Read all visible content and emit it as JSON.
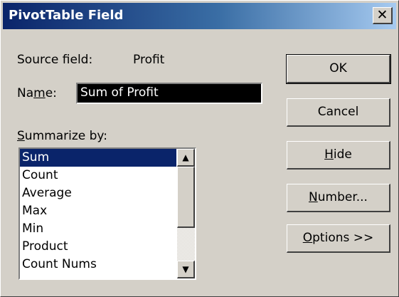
{
  "window": {
    "title": "PivotTable Field",
    "close_glyph": "✕"
  },
  "source": {
    "label": "Source field:",
    "value": "Profit"
  },
  "name": {
    "label_pre": "Na",
    "label_ul": "m",
    "label_post": "e:",
    "value": "Sum of Profit"
  },
  "summarize": {
    "label_ul": "S",
    "label_rest": "ummarize by:"
  },
  "functions": [
    "Sum",
    "Count",
    "Average",
    "Max",
    "Min",
    "Product",
    "Count Nums"
  ],
  "selected_function": "Sum",
  "scrollbar": {
    "up_icon": "up-arrow-icon",
    "down_icon": "down-arrow-icon"
  },
  "buttons": {
    "ok": "OK",
    "cancel": "Cancel",
    "hide": {
      "ul": "H",
      "rest": "ide"
    },
    "number": {
      "ul": "N",
      "rest": "umber..."
    },
    "options": {
      "ul": "O",
      "rest": "ptions >>"
    }
  },
  "colors": {
    "title_bar": "#0a246a",
    "selection": "#0a246a",
    "dialog_face": "#d4d0c8"
  }
}
